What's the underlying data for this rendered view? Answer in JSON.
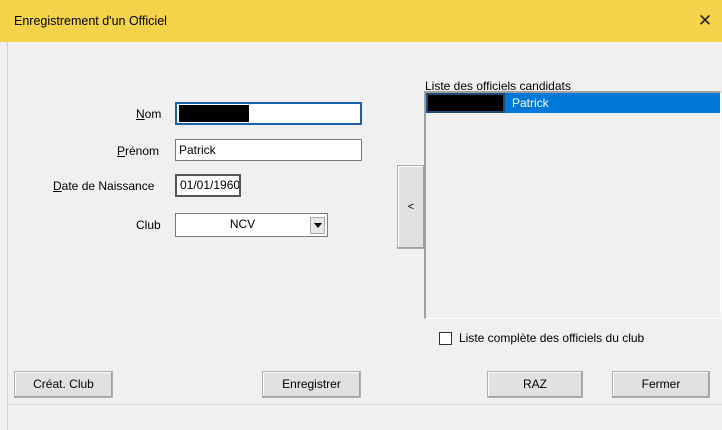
{
  "window": {
    "title": "Enregistrement d'un Officiel",
    "close_glyph": "✕"
  },
  "form": {
    "nom_label": "Nom",
    "nom_value": "",
    "prenom_label": "Prénom",
    "prenom_value": "Patrick",
    "naissance_label": "Date de Naissance",
    "naissance_value": "01/01/1960",
    "club_label": "Club",
    "club_value": "NCV"
  },
  "transfer_button": {
    "label": "<"
  },
  "candidates": {
    "label": "Liste des officiels candidats",
    "items": [
      {
        "name": "Patrick",
        "selected": true
      }
    ],
    "selection_color": "#0078d7"
  },
  "full_list_checkbox": {
    "label": "Liste complète des officiels du club",
    "checked": false
  },
  "buttons": {
    "creat_club": "Créat. Club",
    "enregistrer": "Enregistrer",
    "raz": "RAZ",
    "fermer": "Fermer"
  },
  "colors": {
    "titlebar": "#f2d34a",
    "background": "#f0f0f0",
    "focus_border": "#1c5fae"
  }
}
